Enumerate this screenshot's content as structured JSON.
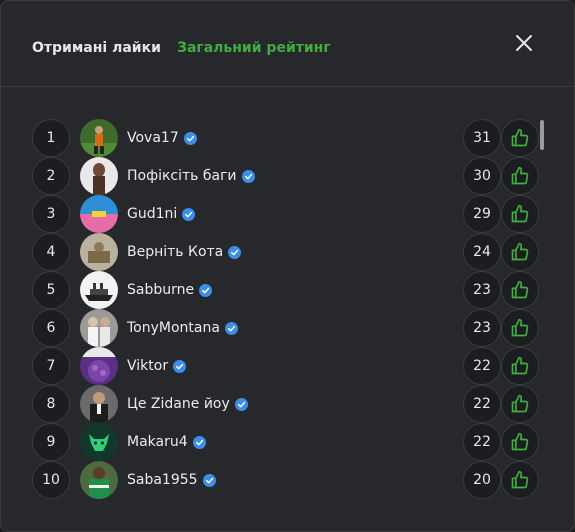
{
  "tabs": [
    {
      "label": "Отримані лайки",
      "active": true
    },
    {
      "label": "Загальний рейтинг",
      "active": false
    }
  ],
  "colors": {
    "accent": "#3fae3f",
    "verified": "#3b8eea"
  },
  "list": [
    {
      "rank": "1",
      "name": "Vova17",
      "count": "31"
    },
    {
      "rank": "2",
      "name": "Пофіксіть баги",
      "count": "30"
    },
    {
      "rank": "3",
      "name": "Gud1ni",
      "count": "29"
    },
    {
      "rank": "4",
      "name": "Верніть Кота",
      "count": "24"
    },
    {
      "rank": "5",
      "name": "Sabburne",
      "count": "23"
    },
    {
      "rank": "6",
      "name": "TonyMontana",
      "count": "23"
    },
    {
      "rank": "7",
      "name": "Viktor",
      "count": "22"
    },
    {
      "rank": "8",
      "name": "Це Zidane йоу",
      "count": "22"
    },
    {
      "rank": "9",
      "name": "Makaru4",
      "count": "22"
    },
    {
      "rank": "10",
      "name": "Saba1955",
      "count": "20"
    }
  ]
}
